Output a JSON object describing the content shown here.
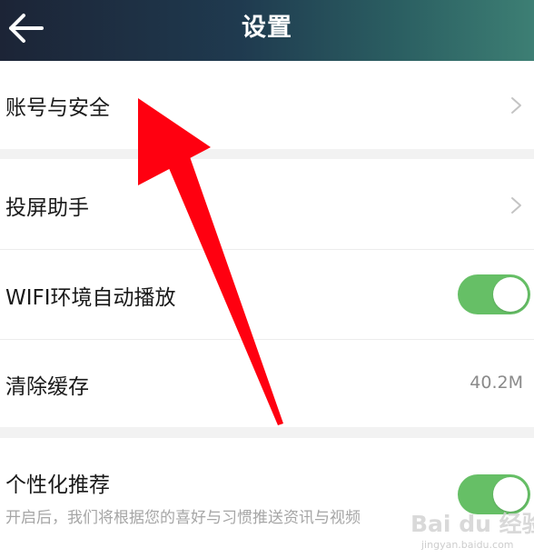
{
  "header": {
    "title": "设置",
    "background_colors": [
      "#1c2436",
      "#3d7f74"
    ]
  },
  "settings": {
    "account_security": {
      "label": "账号与安全",
      "icon": "chevron-right-icon"
    },
    "screen_cast": {
      "label": "投屏助手",
      "icon": "chevron-right-icon"
    },
    "wifi_autoplay": {
      "label": "WIFI环境自动播放",
      "toggle_on": true
    },
    "clear_cache": {
      "label": "清除缓存",
      "value": "40.2M"
    },
    "personalized": {
      "label": "个性化推荐",
      "description": "开启后，我们将根据您的喜好与习惯推送资讯与视频",
      "toggle_on": true
    }
  },
  "annotation": {
    "arrow_color": "#ff0010",
    "points_to": "账号与安全"
  },
  "watermark": {
    "main": "Bai du 经验",
    "sub": "jingyan.baidu.com"
  },
  "colors": {
    "toggle_on": "#66bf66",
    "section_gap": "#f2f2f2",
    "secondary_text": "#8a8a8a"
  }
}
